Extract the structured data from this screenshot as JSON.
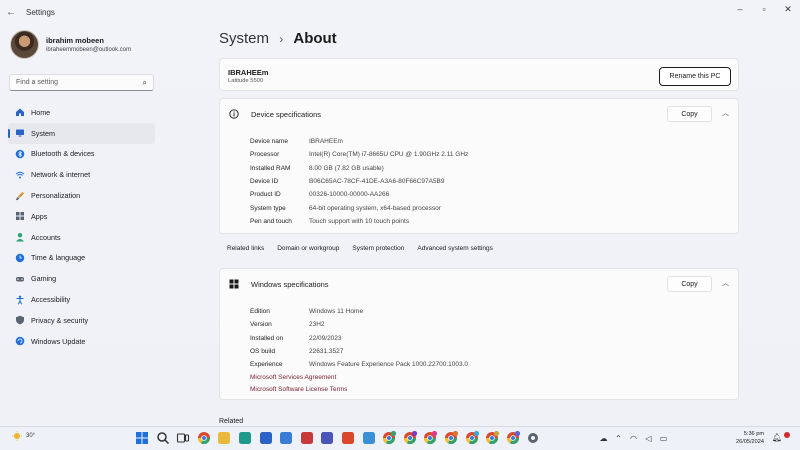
{
  "window": {
    "title": "Settings"
  },
  "profile": {
    "name": "ibrahim mobeen",
    "email": "ibraheemmobeen@outlook.com"
  },
  "search": {
    "placeholder": "Find a setting"
  },
  "sidebar": {
    "items": [
      {
        "label": "Home",
        "icon": "home-icon",
        "color": "#2b62c8"
      },
      {
        "label": "System",
        "icon": "system-icon",
        "color": "#2b62c8",
        "active": true
      },
      {
        "label": "Bluetooth & devices",
        "icon": "bluetooth-icon",
        "color": "#1e6fd9"
      },
      {
        "label": "Network & internet",
        "icon": "wifi-icon",
        "color": "#1e6fd9"
      },
      {
        "label": "Personalization",
        "icon": "brush-icon",
        "color": "#d98a2b"
      },
      {
        "label": "Apps",
        "icon": "apps-icon",
        "color": "#5a6370"
      },
      {
        "label": "Accounts",
        "icon": "person-icon",
        "color": "#2fa36b"
      },
      {
        "label": "Time & language",
        "icon": "globe-clock-icon",
        "color": "#1e6fd9"
      },
      {
        "label": "Gaming",
        "icon": "gamepad-icon",
        "color": "#5a6370"
      },
      {
        "label": "Accessibility",
        "icon": "accessibility-icon",
        "color": "#1e6fd9"
      },
      {
        "label": "Privacy & security",
        "icon": "shield-icon",
        "color": "#5a6370"
      },
      {
        "label": "Windows Update",
        "icon": "update-icon",
        "color": "#1e6fd9"
      }
    ]
  },
  "breadcrumb": {
    "parent": "System",
    "separator": "›",
    "current": "About"
  },
  "pc": {
    "name": "IBRAHEEm",
    "model": "Latitude 5500",
    "rename_label": "Rename this PC"
  },
  "device_specs": {
    "title": "Device specifications",
    "copy_label": "Copy",
    "rows": [
      {
        "label": "Device name",
        "value": "IBRAHEEm"
      },
      {
        "label": "Processor",
        "value": "Intel(R) Core(TM) i7-8665U CPU @ 1.90GHz   2.11 GHz"
      },
      {
        "label": "Installed RAM",
        "value": "8.00 GB (7.82 GB usable)"
      },
      {
        "label": "Device ID",
        "value": "B06C65AC-78CF-41DE-A3A6-80F66C97A5B9"
      },
      {
        "label": "Product ID",
        "value": "00326-10000-00000-AA266"
      },
      {
        "label": "System type",
        "value": "64-bit operating system, x64-based processor"
      },
      {
        "label": "Pen and touch",
        "value": "Touch support with 10 touch points"
      }
    ]
  },
  "related_links": {
    "title": "Related links",
    "links": [
      "Domain or workgroup",
      "System protection",
      "Advanced system settings"
    ]
  },
  "windows_specs": {
    "title": "Windows specifications",
    "copy_label": "Copy",
    "rows": [
      {
        "label": "Edition",
        "value": "Windows 11 Home"
      },
      {
        "label": "Version",
        "value": "23H2"
      },
      {
        "label": "Installed on",
        "value": "22/09/2023"
      },
      {
        "label": "OS build",
        "value": "22631.3527"
      },
      {
        "label": "Experience",
        "value": "Windows Feature Experience Pack 1000.22700.1003.0"
      }
    ],
    "links": [
      "Microsoft Services Agreement",
      "Microsoft Software License Terms"
    ]
  },
  "related": {
    "title": "Related"
  },
  "taskbar": {
    "weather": "30°",
    "time": "5:36 pm",
    "date": "26/05/2024",
    "apps": [
      {
        "icon": "windows-start-icon",
        "color": "#1e6fd9"
      },
      {
        "icon": "search-icon",
        "color": "#333333"
      },
      {
        "icon": "task-view-icon",
        "color": "#333333"
      },
      {
        "icon": "chrome-icon",
        "color": "#d9482b"
      },
      {
        "icon": "file-explorer-icon",
        "color": "#e8b93a"
      },
      {
        "icon": "edge-icon",
        "color": "#1f9a8a"
      },
      {
        "icon": "photos-icon",
        "color": "#2b62c8"
      },
      {
        "icon": "store-icon",
        "color": "#3a7bd5"
      },
      {
        "icon": "app-icon",
        "color": "#c83a3a"
      },
      {
        "icon": "teams-icon",
        "color": "#4b54b8"
      },
      {
        "icon": "gmail-icon",
        "color": "#d9482b"
      },
      {
        "icon": "notepad-icon",
        "color": "#3a8fd5"
      },
      {
        "icon": "chrome-profile-icon",
        "color": "#2fa36b"
      },
      {
        "icon": "chrome-profile-icon",
        "color": "#7a3ac8"
      },
      {
        "icon": "chrome-profile-icon",
        "color": "#d93a8a"
      },
      {
        "icon": "chrome-profile-icon",
        "color": "#d9742b"
      },
      {
        "icon": "chrome-profile-icon",
        "color": "#3aa8d5"
      },
      {
        "icon": "chrome-profile-icon",
        "color": "#c8a23a"
      },
      {
        "icon": "chrome-profile-icon",
        "color": "#5a63d9"
      },
      {
        "icon": "settings-gear-icon",
        "color": "#5a6370"
      }
    ]
  }
}
